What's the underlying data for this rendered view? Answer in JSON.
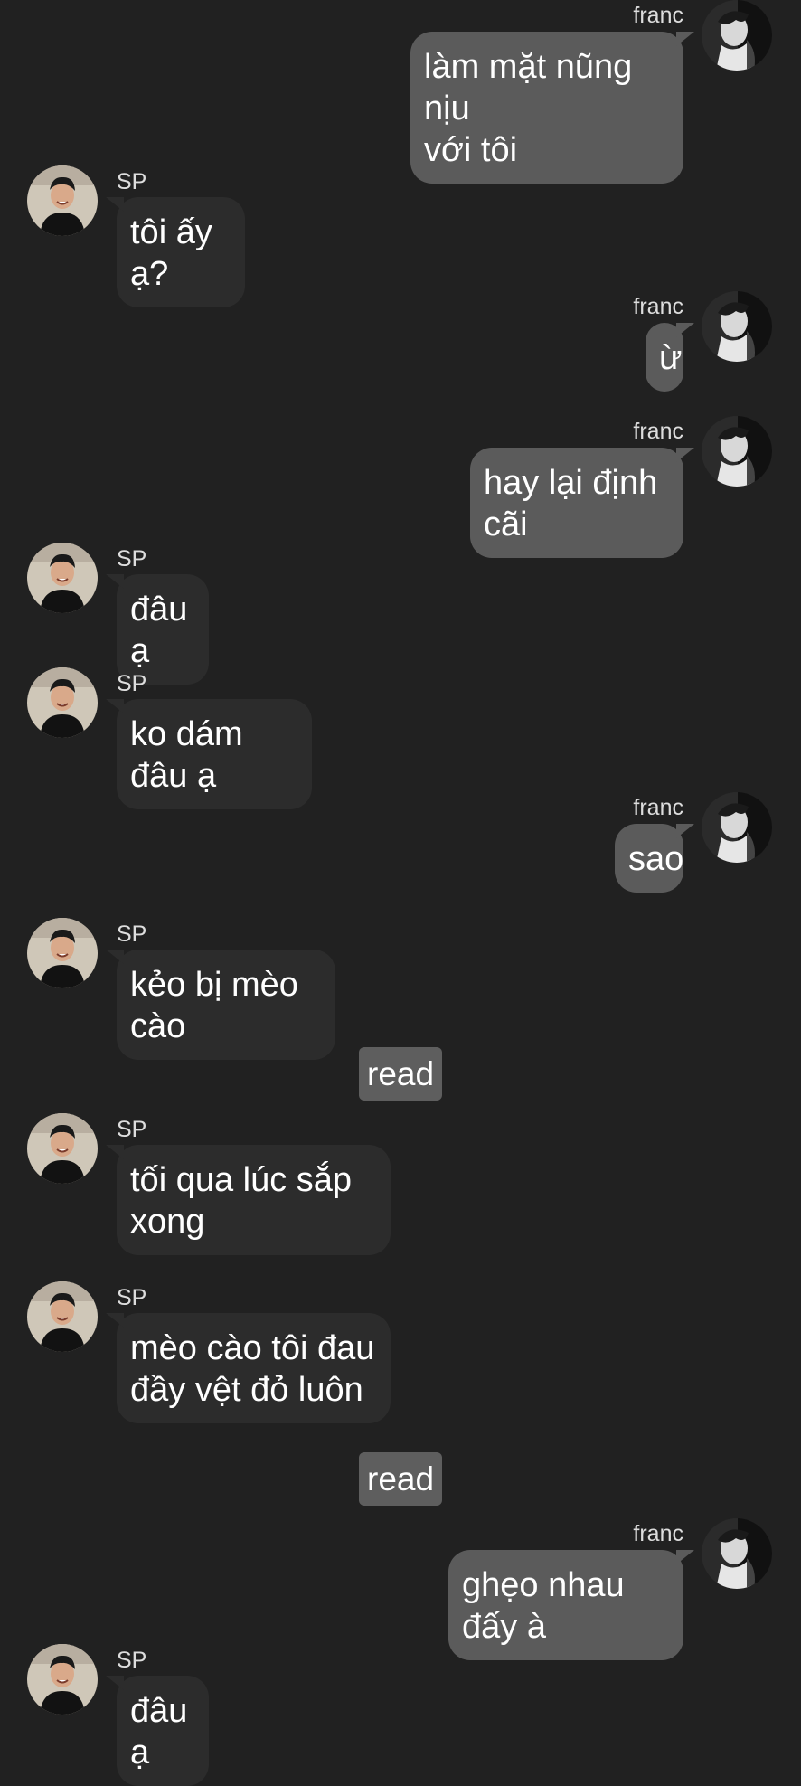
{
  "users": {
    "me": "franc",
    "them": "SP"
  },
  "status": {
    "read": "read"
  },
  "messages": [
    {
      "sender": "me",
      "text": "làm mặt nũng nịu\nvới tôi"
    },
    {
      "sender": "them",
      "text": "tôi ấy ạ?"
    },
    {
      "sender": "me",
      "text": "ừ"
    },
    {
      "sender": "me",
      "text": "hay lại định cãi"
    },
    {
      "sender": "them",
      "text": "đâu ạ"
    },
    {
      "sender": "them",
      "text": "ko dám đâu ạ"
    },
    {
      "sender": "me",
      "text": "sao"
    },
    {
      "sender": "them",
      "text": "kẻo bị mèo cào"
    },
    {
      "sender": "read",
      "text": "read"
    },
    {
      "sender": "them",
      "text": "tối qua lúc sắp\nxong"
    },
    {
      "sender": "them",
      "text": "mèo cào tôi đau\nđầy vệt đỏ luôn"
    },
    {
      "sender": "read",
      "text": "read"
    },
    {
      "sender": "me",
      "text": "ghẹo nhau đấy à"
    },
    {
      "sender": "them",
      "text": "đâu ạ"
    }
  ],
  "icons": {
    "me_avatar": "avatar-franc-icon",
    "them_avatar": "avatar-sp-icon"
  },
  "colors": {
    "background": "#212121",
    "outgoing_bubble": "#5b5b5b",
    "incoming_bubble": "#2c2c2c",
    "read_marker": "#5e5e5e",
    "text": "#ffffff"
  }
}
